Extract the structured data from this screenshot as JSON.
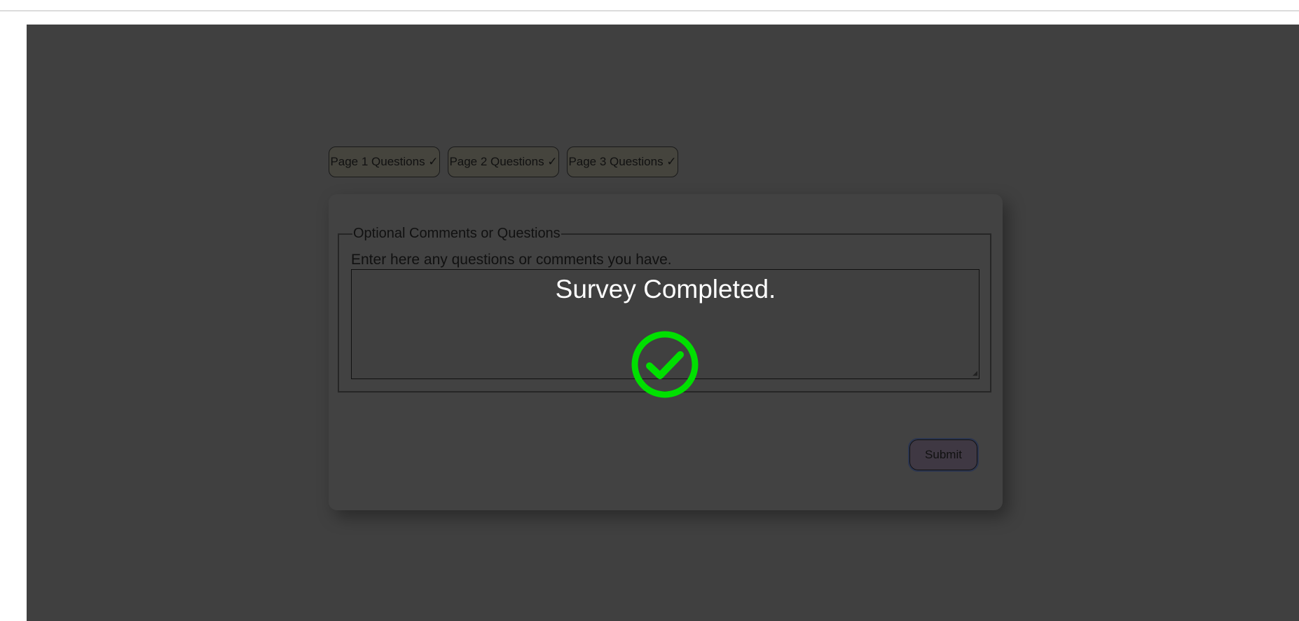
{
  "tabs": [
    {
      "label": "Page 1 Questions ✓"
    },
    {
      "label": "Page 2 Questions ✓"
    },
    {
      "label": "Page 3 Questions ✓"
    }
  ],
  "form": {
    "legend": "Optional Comments or Questions",
    "prompt": "Enter here any questions or comments you have.",
    "comment_value": "",
    "submit_label": "Submit"
  },
  "overlay": {
    "message": "Survey Completed.",
    "icon": "check-circle-icon",
    "icon_color": "#00e000"
  }
}
